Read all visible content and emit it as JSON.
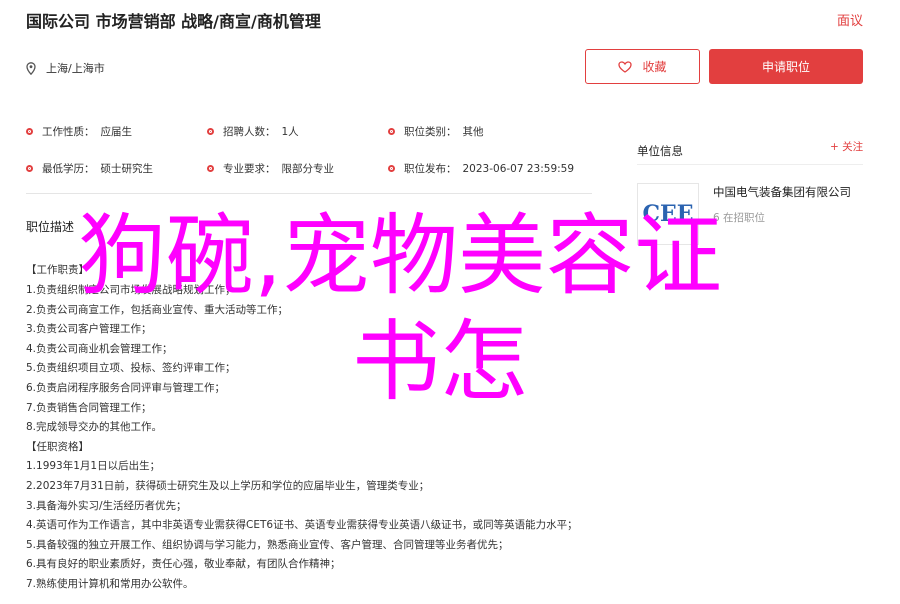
{
  "header": {
    "title": "国际公司 市场营销部 战略/商宣/商机管理",
    "report_label": "面议",
    "location": "上海/上海市",
    "favorite_label": "收藏",
    "apply_label": "申请职位"
  },
  "details": [
    {
      "label": "工作性质：",
      "value": "应届生"
    },
    {
      "label": "招聘人数：",
      "value": "1人"
    },
    {
      "label": "职位类别：",
      "value": "其他"
    },
    {
      "label": "最低学历：",
      "value": "硕士研究生"
    },
    {
      "label": "专业要求：",
      "value": "限部分专业"
    },
    {
      "label": "职位发布：",
      "value": "2023-06-07 23:59:59"
    }
  ],
  "description": {
    "title": "职位描述",
    "lines": [
      "【工作职责】",
      "1.负责组织制定公司市场发展战略规划工作；",
      "2.负责公司商宣工作，包括商业宣传、重大活动等工作；",
      "3.负责公司客户管理工作；",
      "4.负责公司商业机会管理工作；",
      "5.负责组织项目立项、投标、签约评审工作；",
      "6.负责启闭程序服务合同评审与管理工作；",
      "7.负责销售合同管理工作；",
      "8.完成领导交办的其他工作。",
      "【任职资格】",
      "1.1993年1月1日以后出生；",
      "2.2023年7月31日前，获得硕士研究生及以上学历和学位的应届毕业生，管理类专业；",
      "3.具备海外实习/生活经历者优先；",
      "4.英语可作为工作语言，其中非英语专业需获得CET6证书、英语专业需获得专业英语八级证书，或同等英语能力水平；",
      "5.具备较强的独立开展工作、组织协调与学习能力，熟悉商业宣传、客户管理、合同管理等业务者优先；",
      "6.具有良好的职业素质好，责任心强，敬业奉献，有团队合作精神；",
      "7.熟练使用计算机和常用办公软件。"
    ]
  },
  "sidebar": {
    "title": "单位信息",
    "follow_label": "+ 关注",
    "logo_text": "CEE",
    "company_name": "中国电气装备集团有限公司",
    "company_sub": "6 在招职位"
  },
  "watermark": {
    "line1": "狗碗,宠物美容证",
    "line2": "书怎"
  },
  "colors": {
    "accent": "#e23f3f",
    "watermark": "#ff00ff"
  }
}
